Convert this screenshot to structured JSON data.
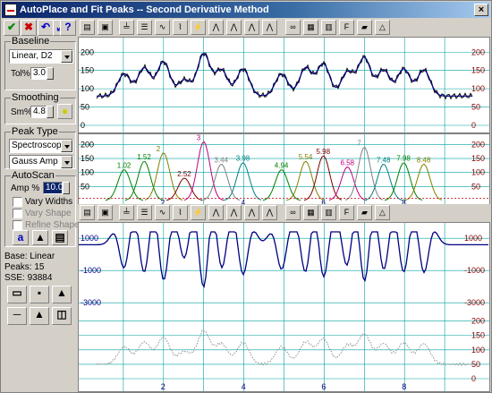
{
  "window": {
    "title": "AutoPlace and Fit Peaks -- Second Derivative Method"
  },
  "left": {
    "tool_icons": [
      "check-icon",
      "close-icon",
      "undo-icon",
      "fit-icon",
      "help-icon"
    ],
    "baseline": {
      "label": "Baseline",
      "type": "Linear, D2",
      "tol_label": "Tol%",
      "tol_value": "3.0"
    },
    "smoothing": {
      "label": "Smoothing",
      "sm_label": "Sm%",
      "sm_value": "4.8"
    },
    "peak_type": {
      "label": "Peak Type",
      "category": "Spectroscopy",
      "function": "Gauss Amp"
    },
    "autoscan": {
      "label": "AutoScan",
      "amp_label": "Amp %",
      "amp_value": "10.00",
      "vary_widths": "Vary Widths",
      "vary_shape": "Vary Shape",
      "refine_shape": "Refine Shape"
    },
    "status": {
      "base": "Base: Linear",
      "peaks": "Peaks:  15",
      "sse": "SSE:  93884"
    }
  },
  "top_plot": {
    "y_ticks": [
      "200",
      "150",
      "100",
      "50",
      "0"
    ]
  },
  "peaks_plot": {
    "y_ticks": [
      "200",
      "150",
      "100",
      "50"
    ],
    "peak_labels": [
      "1.02",
      "1.52",
      "2",
      "2.52",
      "3",
      "3.44",
      "3.98",
      "4.94",
      "5.54",
      "5.98",
      "6.58",
      "7",
      "7.48",
      "7.98",
      "8.48"
    ],
    "small_labels": [
      "2",
      "4",
      "6",
      "8"
    ]
  },
  "deriv_plot": {
    "y_ticks": [
      "1000",
      "-1000",
      "-3000"
    ]
  },
  "bottom_plot": {
    "y_ticks": [
      "200",
      "150",
      "100",
      "50",
      "0"
    ]
  },
  "x_axis": {
    "ticks": [
      "2",
      "4",
      "6",
      "8"
    ]
  },
  "colors": {
    "accent": "#0a246a",
    "curve": "#000080",
    "residual": "#808000",
    "grid": "#00a0a0"
  }
}
